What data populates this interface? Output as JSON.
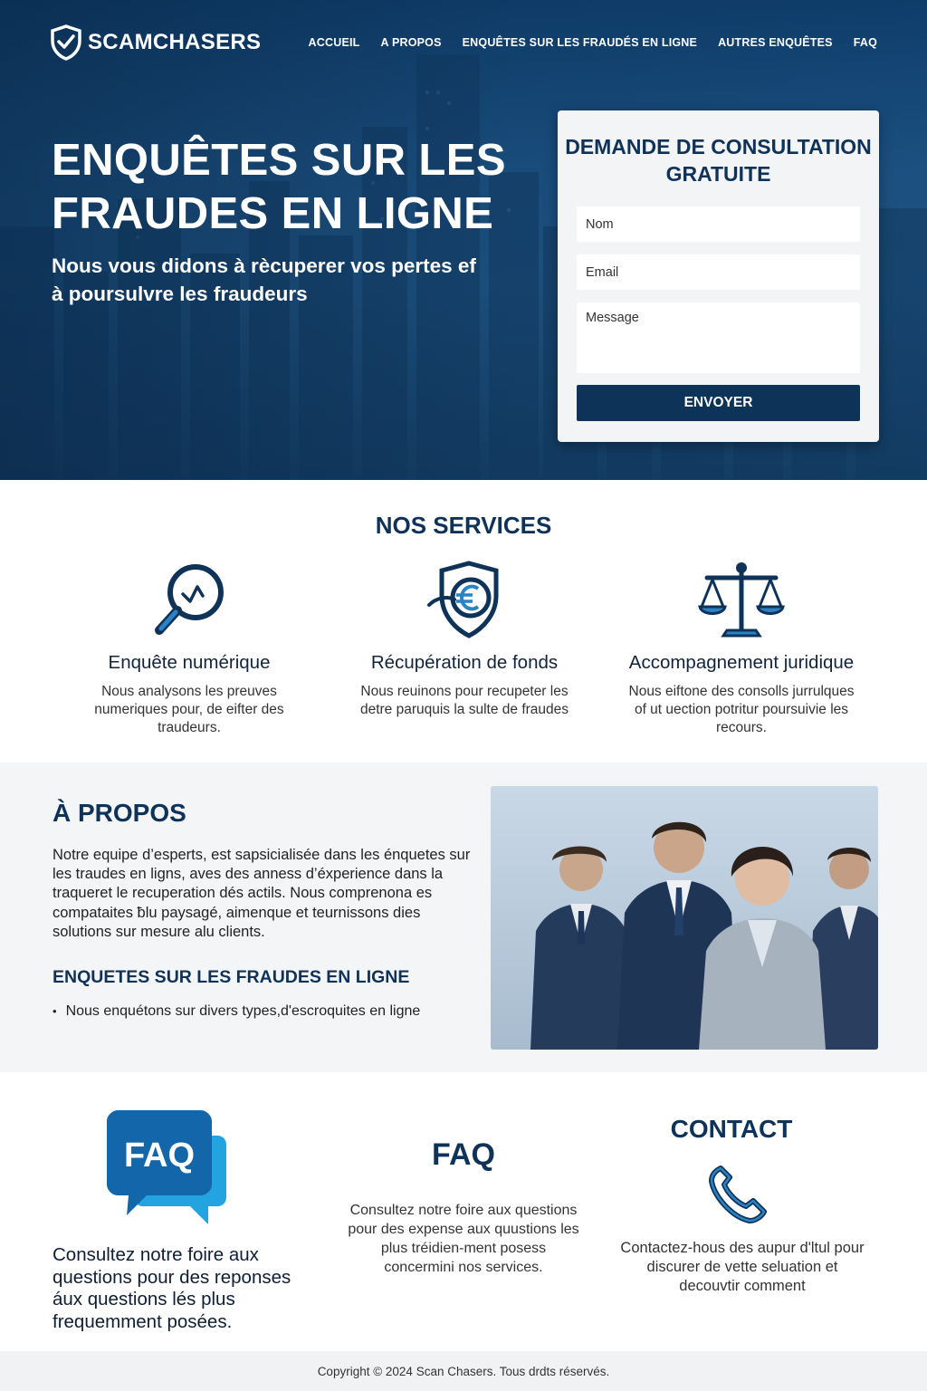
{
  "brand": {
    "name": "SCAMCHASERS"
  },
  "nav": {
    "items": [
      {
        "label": "ACCUEIL"
      },
      {
        "label": "A PROPOS"
      },
      {
        "label": "ENQUÊTES SUR LES FRAUDÉS EN LIGNE"
      },
      {
        "label": "AUTRES ENQUÊTES"
      },
      {
        "label": "FAQ"
      }
    ]
  },
  "hero": {
    "title": "ENQUÊTES SUR LES FRAUDES EN LIGNE",
    "subtitle": "Nous vous didons à rècuperer vos pertes ef à poursulvre les fraudeurs"
  },
  "form": {
    "title": "DEMANDE DE CONSULTATION GRATUITE",
    "name_placeholder": "Nom",
    "email_placeholder": "Email",
    "message_placeholder": "Message",
    "submit_label": "ENVOYER"
  },
  "services": {
    "title": "NOS SERVICES",
    "items": [
      {
        "icon": "magnifier-icon",
        "title": "Enquête numérique",
        "text": "Nous analysons les preuves numeriques pour, de eifter des traudeurs."
      },
      {
        "icon": "euro-shield-icon",
        "title": "Récupération de fonds",
        "text": "Nous reuinons pour recupeter les detre paruquis la sulte de fraudes"
      },
      {
        "icon": "scales-icon",
        "title": "Accompagnement juridique",
        "text": "Nous eiftone des consolls jurrulques of ut uection potritur poursuivie les recours."
      }
    ]
  },
  "about": {
    "title": "À PROPOS",
    "text": "Notre equipe d’esperts, est sapsicialisée dans les énquetes sur les traudes en ligns, aves des anness d’éxperience dans la traqueret le recuperation dés actils. Nous comprenona es compataites ƀlu paysagé, aimenque et teurnissons dies solutions sur mesure alu clients.",
    "subtitle": "ENQUETES SUR LES FRAUDES EN LIGNE",
    "list": [
      "Nous enquétons sur divers types,d'escroquites en ligne"
    ]
  },
  "faq": {
    "icon_label": "FAQ",
    "left_text": "Consultez notre foire aux questions pour des reponses áux questions lés plus frequemment posées.",
    "title": "FAQ",
    "text": "Consultez notre foire aux questions pour des expense aux quustions les plus tréidien-ment posess concermini nos services."
  },
  "contact": {
    "title": "CONTACT",
    "text": "Contactez-hous des aupur d'ltul pour discurer de vette seluation et decouvtir comment"
  },
  "footer": {
    "text": "Copyright © 2024 Scan Chasers. Tous drdts réservés."
  },
  "colors": {
    "primary": "#0f3358",
    "accent": "#1b74b8",
    "hero_bg": "#1c5283"
  }
}
